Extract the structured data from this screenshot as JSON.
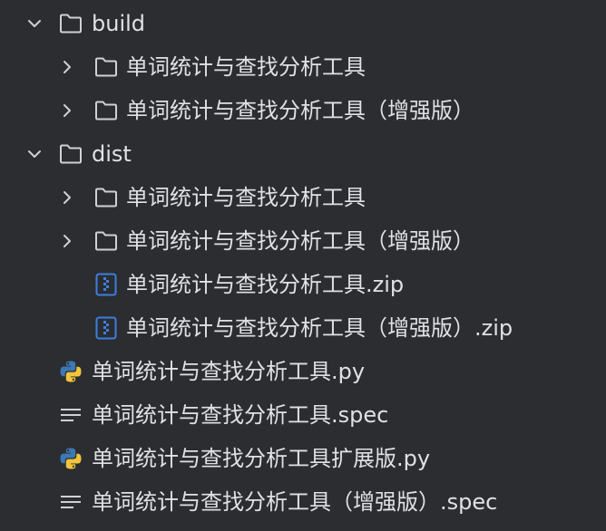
{
  "tree": {
    "build": {
      "label": "build",
      "children": [
        "单词统计与查找分析工具",
        "单词统计与查找分析工具（增强版）"
      ]
    },
    "dist": {
      "label": "dist",
      "folders": [
        "单词统计与查找分析工具",
        "单词统计与查找分析工具（增强版）"
      ],
      "zips": [
        "单词统计与查找分析工具.zip",
        "单词统计与查找分析工具（增强版）.zip"
      ]
    },
    "files": [
      "单词统计与查找分析工具.py",
      "单词统计与查找分析工具.spec",
      "单词统计与查找分析工具扩展版.py",
      "单词统计与查找分析工具（增强版）.spec"
    ]
  },
  "colors": {
    "background": "#2b2d30",
    "text": "#dfe1e5",
    "folder_outline": "#cfd1d5",
    "chevron": "#cfd1d5",
    "zip_blue": "#3d7fe0",
    "python_blue": "#3c78b4",
    "python_yellow": "#f2c43c"
  },
  "icons": {
    "folder": "folder-icon",
    "chevron_down": "chevron-down-icon",
    "chevron_right": "chevron-right-icon",
    "zip": "zip-archive-icon",
    "python": "python-file-icon",
    "text": "text-file-icon"
  }
}
